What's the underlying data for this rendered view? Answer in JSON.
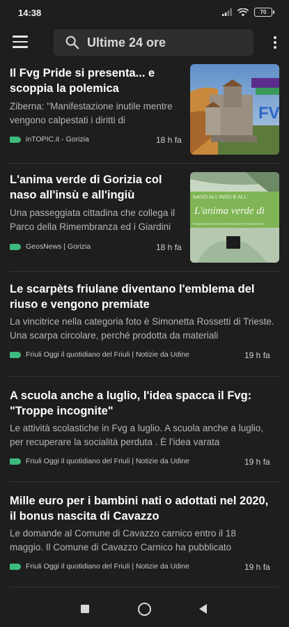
{
  "status": {
    "time": "14:38",
    "battery": "70"
  },
  "search": {
    "text": "Ultime 24 ore"
  },
  "articles": [
    {
      "title": "Il Fvg Pride si presenta... e scoppia la polemica",
      "summary": "Ziberna: \"Manifestazione inutile mentre vengono calpestati i diritti di",
      "source": "inTOPIC.it - Gorizia",
      "time": "18 h fa",
      "thumb": {
        "logo_text": "FVG PRIDE"
      }
    },
    {
      "title": "L'anima verde di Gorizia col naso all'insù e all'ingiù",
      "summary": "Una passeggiata cittadina che collega il Parco della Rimembranza ed i Giardini",
      "source": "GeosNews | Gorizia",
      "time": "18 h fa",
      "thumb": {
        "line1": "NASO ALL'INSÙ E ALL'",
        "line2": "L'anima verde di",
        "line3": "PASSEGGIATA CON ANTOLOGIA FOTOGRAFICA"
      }
    },
    {
      "title": "Le scarpèts friulane diventano l'emblema del riuso e vengono premiate",
      "summary": "La vincitrice nella categoria foto è Simonetta Rossetti di Trieste. Una scarpa circolare, perché prodotta da materiali",
      "source": "Friuli Oggi il quotidiano del Friuli | Notizie da Udine",
      "time": "19 h fa"
    },
    {
      "title": "A scuola anche a luglio, l'idea spacca il Fvg: \"Troppe incognite\"",
      "summary": "Le attività scolastiche in Fvg a luglio. A scuola anche a luglio, per recuperare la socialità perduta . È l'idea varata",
      "source": "Friuli Oggi il quotidiano del Friuli | Notizie da Udine",
      "time": "19 h fa"
    },
    {
      "title": "Mille euro per i bambini nati o adottati nel 2020, il bonus nascita di Cavazzo",
      "summary": "Le domande al Comune di Cavazzo carnico entro il 18 maggio. Il Comune di Cavazzo Carnico ha pubblicato",
      "source": "Friuli Oggi il quotidiano del Friuli | Notizie da Udine",
      "time": "19 h fa"
    }
  ],
  "colors": {
    "background": "#1e1e1e",
    "tag": "#3dba7d"
  }
}
